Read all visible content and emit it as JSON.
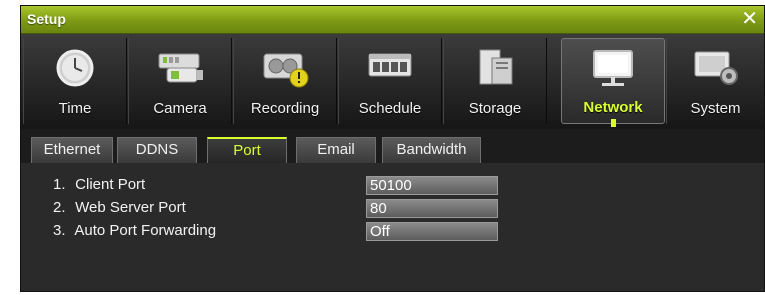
{
  "window": {
    "title": "Setup",
    "close_glyph": "✕"
  },
  "toolbar": {
    "items": [
      {
        "label": "Time",
        "icon": "clock-icon"
      },
      {
        "label": "Camera",
        "icon": "camera-icon"
      },
      {
        "label": "Recording",
        "icon": "recording-icon"
      },
      {
        "label": "Schedule",
        "icon": "schedule-icon"
      },
      {
        "label": "Storage",
        "icon": "storage-icon"
      },
      {
        "label": "Network",
        "icon": "monitor-icon",
        "active": true
      },
      {
        "label": "System",
        "icon": "system-gear-icon"
      }
    ]
  },
  "tabs": [
    {
      "label": "Ethernet"
    },
    {
      "label": "DDNS"
    },
    {
      "label": "Port",
      "active": true
    },
    {
      "label": "Email"
    },
    {
      "label": "Bandwidth"
    }
  ],
  "settings": [
    {
      "num": "1.",
      "label": "Client Port",
      "value": "50100"
    },
    {
      "num": "2.",
      "label": "Web Server Port",
      "value": "80"
    },
    {
      "num": "3.",
      "label": "Auto Port Forwarding",
      "value": "Off"
    }
  ],
  "colors": {
    "accent": "#d9ff2c",
    "titlebar": "#8aa61a",
    "background": "#2a2a2a"
  }
}
